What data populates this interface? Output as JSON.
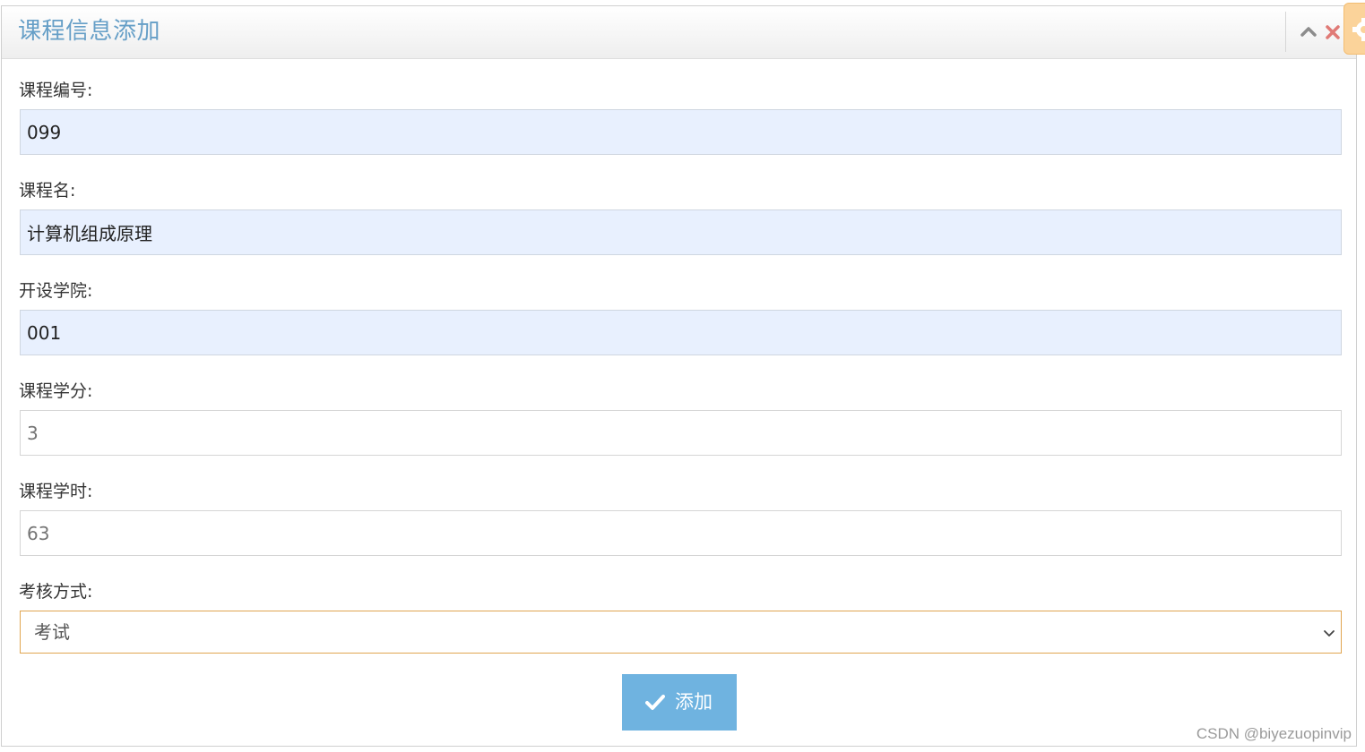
{
  "window": {
    "title": "课程信息添加"
  },
  "form": {
    "fields": [
      {
        "label": "课程编号:",
        "value": "099"
      },
      {
        "label": "课程名:",
        "value": "计算机组成原理"
      },
      {
        "label": "开设学院:",
        "value": "001"
      },
      {
        "label": "课程学分:",
        "placeholder": "3"
      },
      {
        "label": "课程学时:",
        "placeholder": "63"
      }
    ],
    "exam_method": {
      "label": "考核方式:",
      "selected": "考试"
    },
    "submit_label": "添加"
  },
  "watermark": "CSDN @biyezuopinvip",
  "colors": {
    "title": "#669fc7",
    "autofill_bg": "#e8f0fe",
    "button_bg": "#6fb3e0",
    "close_icon": "#e07a76",
    "select_border": "#e0a550",
    "settings_tab": "#fbd39a"
  },
  "icons": {
    "collapse": "chevron-up-icon",
    "close": "close-icon",
    "settings": "gear-icon",
    "select": "chevron-down-icon",
    "submit": "check-icon"
  }
}
